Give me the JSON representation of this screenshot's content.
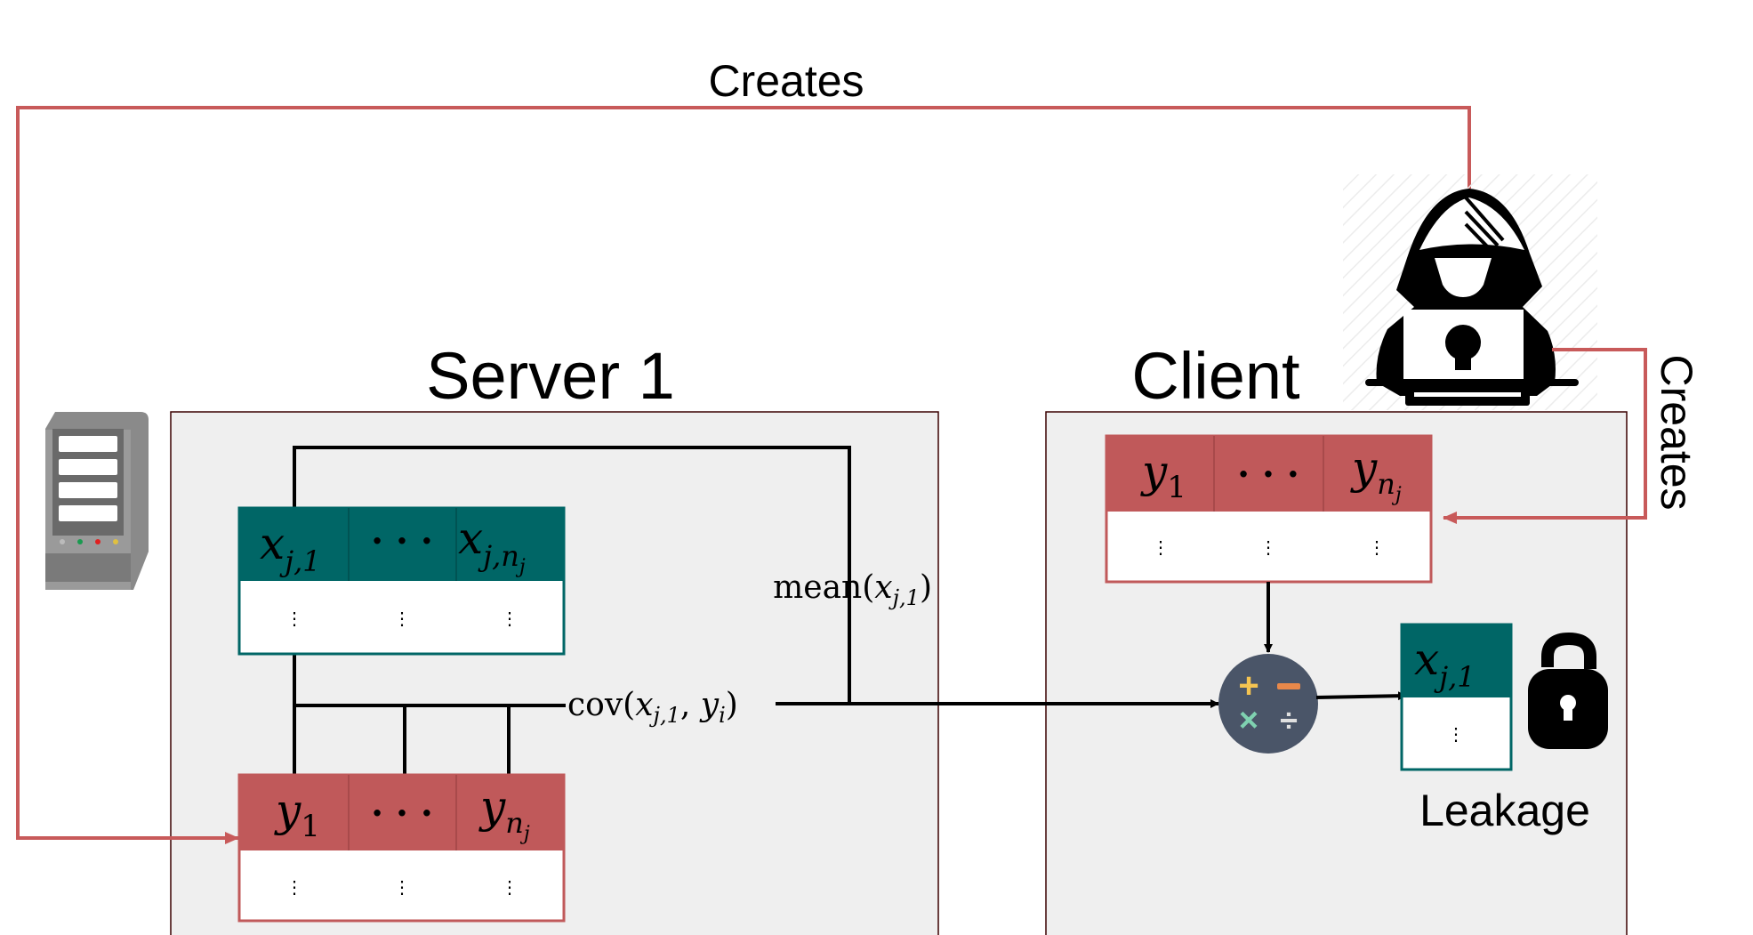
{
  "labels": {
    "creates_top": "Creates",
    "creates_side": "Creates",
    "server_title": "Server 1",
    "client_title": "Client",
    "leakage": "Leakage"
  },
  "math": {
    "x": "x",
    "j1": "j,1",
    "jnj": "j,n",
    "nj_sub": "j",
    "y": "y",
    "one": "1",
    "n": "n",
    "ellipsis": "· · ·",
    "vdots": "⋮",
    "mean_fn": "mean(",
    "mean_arg": "x",
    "mean_sub": "j,1",
    "close": ")",
    "cov_fn": "cov(",
    "cov_x": "x",
    "cov_xsub": "j,1",
    "cov_sep": ", ",
    "cov_y": "y",
    "cov_ysub": "i"
  },
  "icons": [
    "server-icon",
    "hacker-icon",
    "calculator-icon",
    "unlocked-padlock-icon"
  ],
  "colors": {
    "red": "#c0595a",
    "teal": "#006666",
    "arrow_red": "#c85a5a",
    "panel": "#efefef",
    "calc_bg": "#4a5568"
  }
}
